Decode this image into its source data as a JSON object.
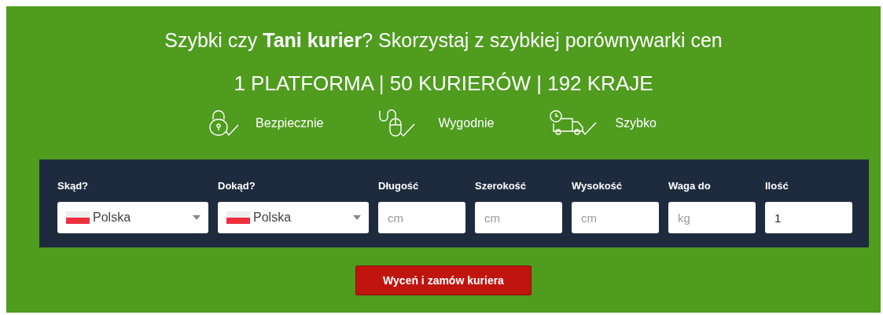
{
  "headline": "Szybki czy **Tani kurier**? Skorzystaj z szybkiej porównywarki cen",
  "tagline": "1 PLATFORMA | 50 KURIERÓW | 192 KRAJE",
  "features": [
    {
      "kind": "lock",
      "label": "Bezpiecznie"
    },
    {
      "kind": "mouse",
      "label": "Wygodnie"
    },
    {
      "kind": "truck",
      "label": "Szybko"
    }
  ],
  "fields": [
    {
      "kind": "select",
      "label": "Skąd?",
      "value": "Polska"
    },
    {
      "kind": "select",
      "label": "Dokąd?",
      "value": "Polska"
    },
    {
      "kind": "input",
      "label": "Długość",
      "placeholder": "cm"
    },
    {
      "kind": "input",
      "label": "Szerokość",
      "placeholder": "cm"
    },
    {
      "kind": "input",
      "label": "Wysokość",
      "placeholder": "cm"
    },
    {
      "kind": "input",
      "label": "Waga do",
      "placeholder": "kg"
    },
    {
      "kind": "input",
      "label": "Ilość",
      "value": "1"
    }
  ],
  "submit": "Wyceń i zamów kuriera"
}
